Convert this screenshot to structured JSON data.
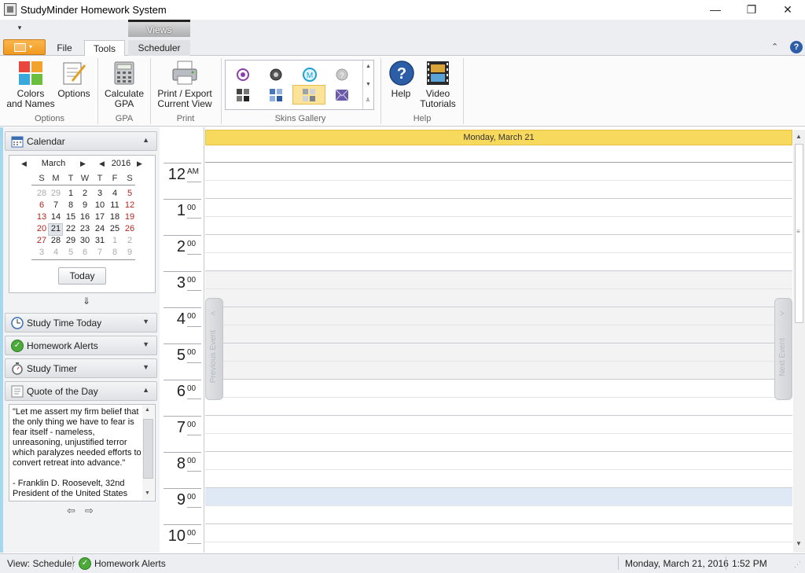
{
  "window": {
    "title": "StudyMinder Homework System",
    "minimize": "—",
    "restore": "❐",
    "close": "✕"
  },
  "qat": {
    "customize": "▾"
  },
  "context_tab": {
    "label": "Views"
  },
  "tabs": [
    {
      "label": "File"
    },
    {
      "label": "Tools",
      "active": true
    },
    {
      "label": "Scheduler"
    }
  ],
  "ribbon": {
    "groups": {
      "options": "Options",
      "gpa": "GPA",
      "print": "Print",
      "skins": "Skins Gallery",
      "help": "Help"
    },
    "buttons": {
      "colors": "Colors\nand Names",
      "options": "Options",
      "calc_gpa": "Calculate\nGPA",
      "print_export": "Print / Export\nCurrent View",
      "help": "Help",
      "video": "Video\nTutorials"
    },
    "collapse_glyph": "⌃",
    "help_glyph": "?"
  },
  "sidebar": {
    "calendar": {
      "title": "Calendar",
      "month": "March",
      "year": "2016",
      "dow": [
        "S",
        "M",
        "T",
        "W",
        "T",
        "F",
        "S"
      ],
      "weeks": [
        [
          "28",
          "29",
          "1",
          "2",
          "3",
          "4",
          "5"
        ],
        [
          "6",
          "7",
          "8",
          "9",
          "10",
          "11",
          "12"
        ],
        [
          "13",
          "14",
          "15",
          "16",
          "17",
          "18",
          "19"
        ],
        [
          "20",
          "21",
          "22",
          "23",
          "24",
          "25",
          "26"
        ],
        [
          "27",
          "28",
          "29",
          "30",
          "31",
          "1",
          "2"
        ],
        [
          "3",
          "4",
          "5",
          "6",
          "7",
          "8",
          "9"
        ]
      ],
      "selected_day": "21",
      "today_label": "Today",
      "down_arrow": "⇓"
    },
    "panels": [
      {
        "label": "Study Time Today",
        "icon": "clock-icon"
      },
      {
        "label": "Homework Alerts",
        "icon": "check-circle-icon"
      },
      {
        "label": "Study Timer",
        "icon": "stopwatch-icon"
      },
      {
        "label": "Quote of the Day",
        "icon": "quote-icon"
      }
    ],
    "quote": {
      "text": "\"Let me assert my firm belief that the only thing we have to fear is fear itself - nameless, unreasoning, unjustified terror which paralyzes needed efforts to convert retreat into advance.\"\n\n- Franklin D. Roosevelt, 32nd President of the United States",
      "prev": "⇦",
      "next": "⇨"
    }
  },
  "scheduler": {
    "date_header": "Monday, March 21",
    "hours": [
      {
        "h": "12",
        "m": "AM"
      },
      {
        "h": "1",
        "m": "00"
      },
      {
        "h": "2",
        "m": "00"
      },
      {
        "h": "3",
        "m": "00"
      },
      {
        "h": "4",
        "m": "00"
      },
      {
        "h": "5",
        "m": "00"
      },
      {
        "h": "6",
        "m": "00"
      },
      {
        "h": "7",
        "m": "00"
      },
      {
        "h": "8",
        "m": "00"
      },
      {
        "h": "9",
        "m": "00"
      },
      {
        "h": "10",
        "m": "00"
      }
    ],
    "previous_event": "Previous Event",
    "next_event": "Next Event"
  },
  "statusbar": {
    "view": "View: Scheduler",
    "alerts": "Homework Alerts",
    "date": "Monday, March 21, 2016",
    "time": "1:52 PM"
  },
  "colors": {
    "accent": "#f7d95d",
    "appmenu": "#f09a20",
    "sidebar_edge": "#a5d7ee"
  }
}
